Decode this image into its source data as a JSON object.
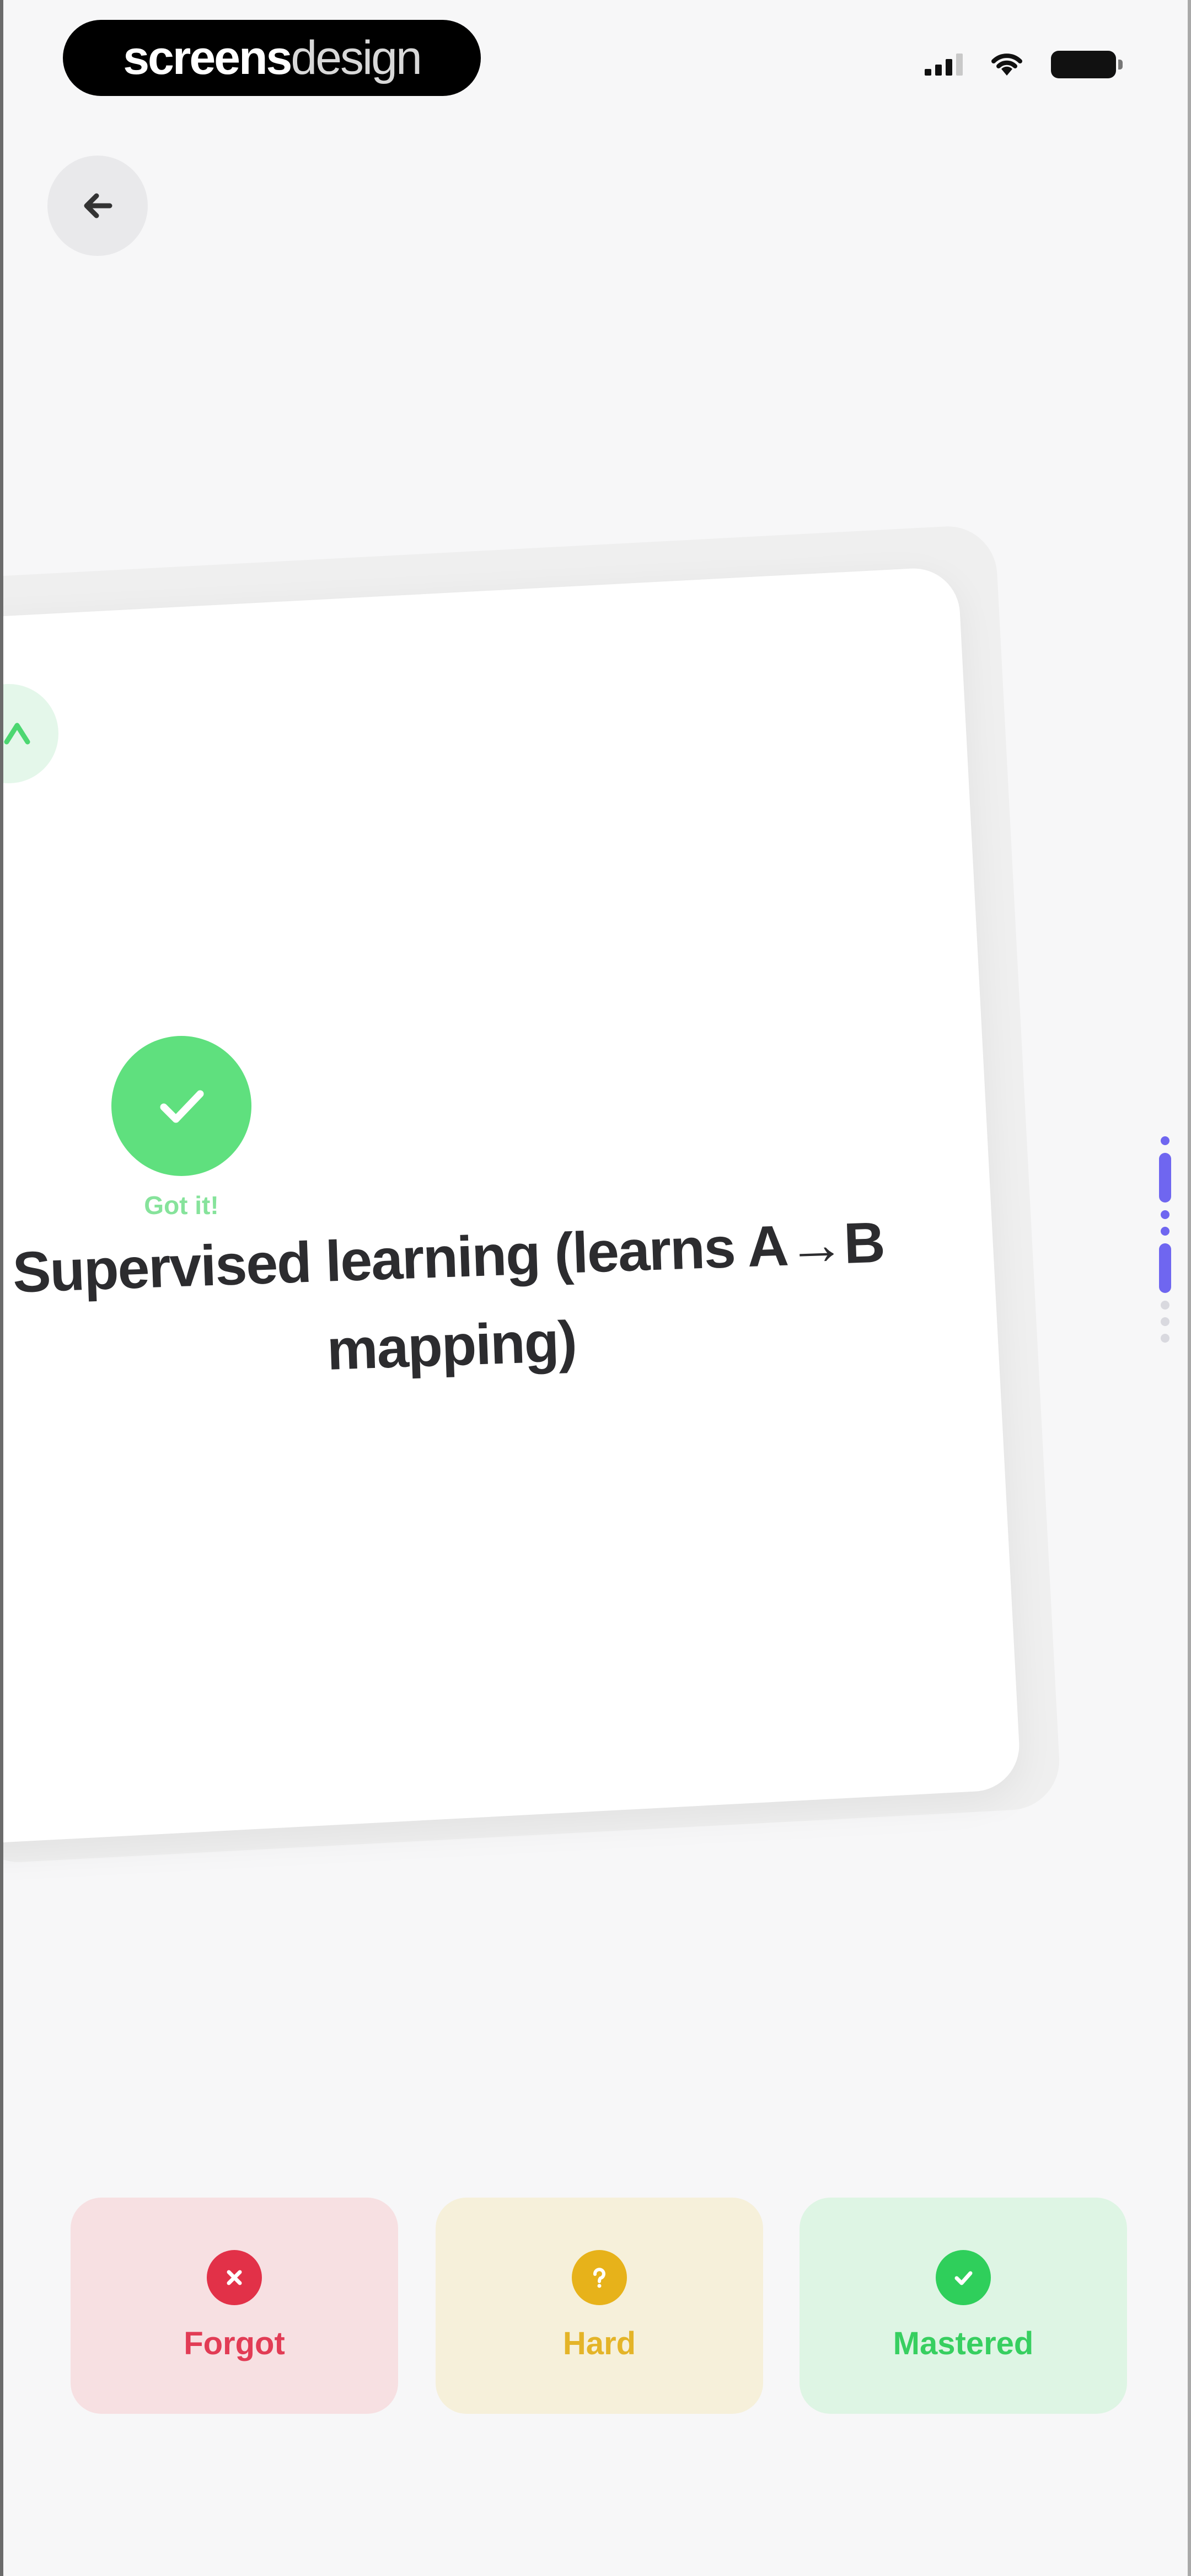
{
  "status_bar": {
    "brand_part1": "screens",
    "brand_part2": "design",
    "icons": [
      "signal-icon",
      "wifi-icon",
      "battery-icon"
    ]
  },
  "navigation": {
    "back_icon": "arrow-left-icon"
  },
  "flashcard": {
    "status_label": "Got it!",
    "answer_text": "Supervised learning (learns A→B mapping)"
  },
  "progress": {
    "indicator_color": "#6f66f0"
  },
  "rating_buttons": [
    {
      "label": "Forgot",
      "icon": "x-circle-icon",
      "color": "#e23148"
    },
    {
      "label": "Hard",
      "icon": "question-circle-icon",
      "color": "#e7b21a"
    },
    {
      "label": "Mastered",
      "icon": "check-circle-icon",
      "color": "#2fcf5b"
    }
  ]
}
